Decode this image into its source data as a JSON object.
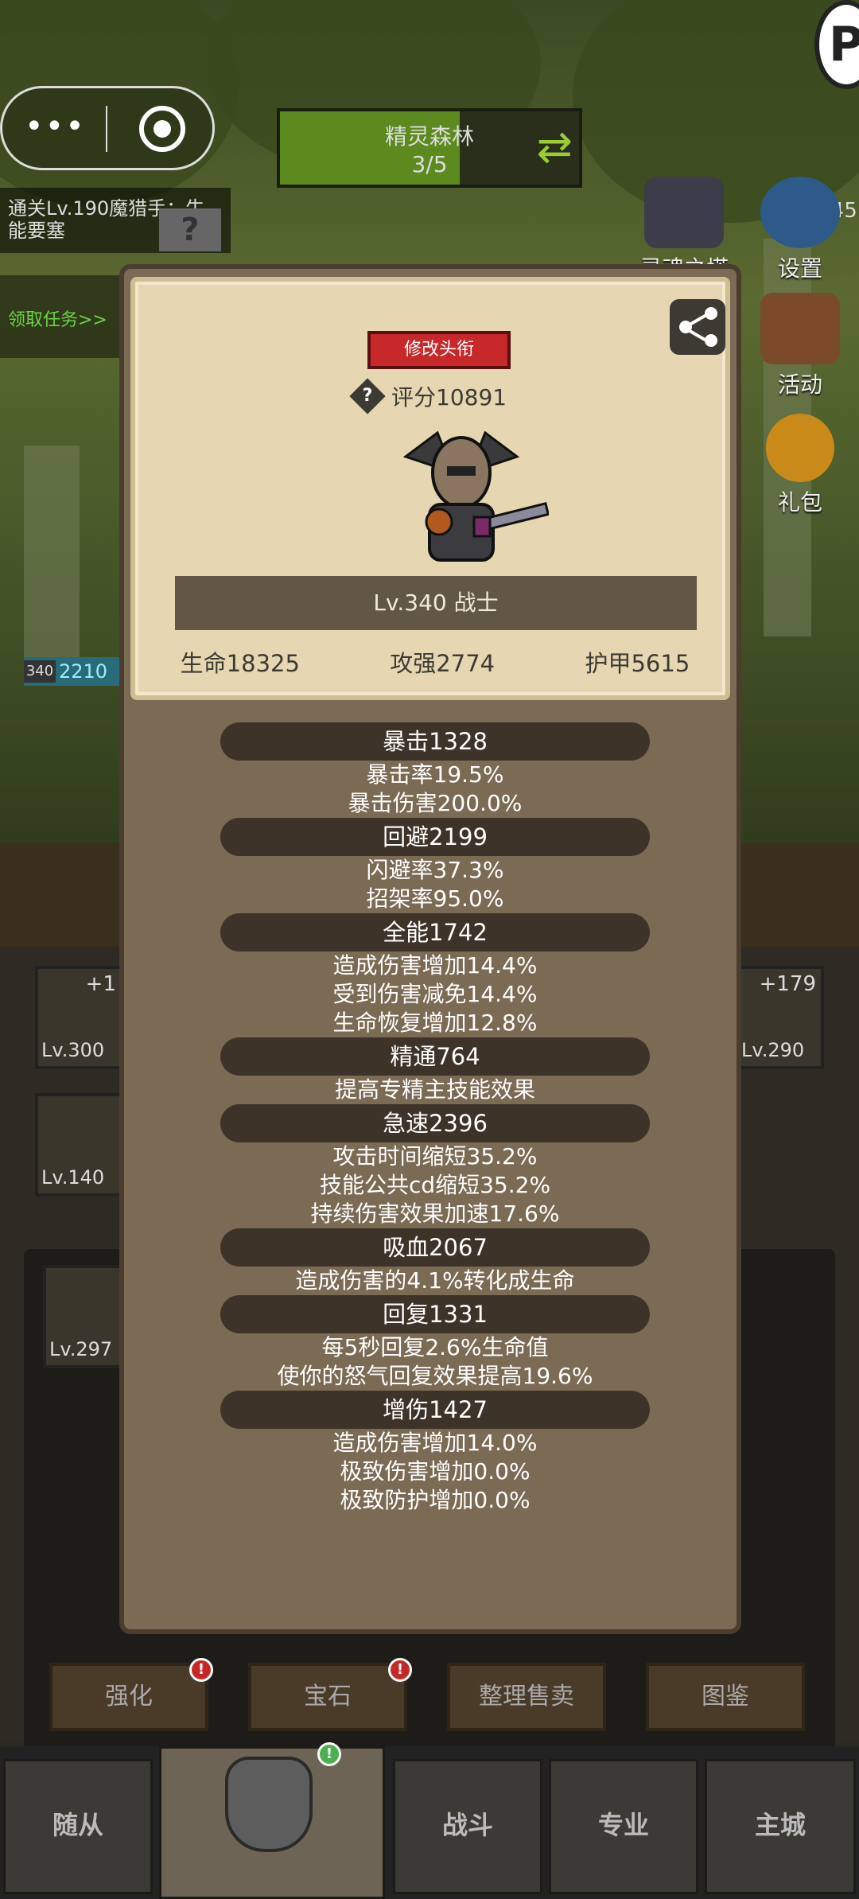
{
  "top": {
    "map_name": "精灵森林",
    "map_progress": "3/5",
    "map_progress_fraction": 0.6,
    "stage_info": "通关Lv.190魔猎手：牛能要塞",
    "task_link": "领取任务>>",
    "player_level_badge": "Lv.445",
    "capsule_menu_icon": "more-dots-icon",
    "capsule_close_icon": "record-circle-icon"
  },
  "side_buttons": [
    {
      "label": "灵魂之塔",
      "icon": "tower-icon"
    },
    {
      "label": "设置",
      "icon": "gear-icon"
    },
    {
      "label": "活动",
      "icon": "scroll-icon"
    },
    {
      "label": "礼包",
      "icon": "gift-coin-icon"
    }
  ],
  "hero_bar": {
    "level": "340",
    "value": "2210"
  },
  "equip_slots": [
    {
      "level": "Lv.300",
      "plus": "+1"
    },
    {
      "level": "Lv.290",
      "plus": "+179"
    },
    {
      "level": "Lv.140",
      "plus": ""
    },
    {
      "level": "Lv.297",
      "plus": ""
    }
  ],
  "panel": {
    "edit_title_button": "修改头衔",
    "rating": "评分10891",
    "hero_name": "Lv.340 战士",
    "core_stats": [
      "生命18325",
      "攻强2774",
      "护甲5615"
    ],
    "groups": [
      {
        "header": "暴击1328",
        "lines": [
          "暴击率19.5%",
          "暴击伤害200.0%"
        ]
      },
      {
        "header": "回避2199",
        "lines": [
          "闪避率37.3%",
          "招架率95.0%"
        ]
      },
      {
        "header": "全能1742",
        "lines": [
          "造成伤害增加14.4%",
          "受到伤害减免14.4%",
          "生命恢复增加12.8%"
        ]
      },
      {
        "header": "精通764",
        "lines": [
          "提高专精主技能效果"
        ]
      },
      {
        "header": "急速2396",
        "lines": [
          "攻击时间缩短35.2%",
          "技能公共cd缩短35.2%",
          "持续伤害效果加速17.6%"
        ]
      },
      {
        "header": "吸血2067",
        "lines": [
          "造成伤害的4.1%转化成生命"
        ]
      },
      {
        "header": "回复1331",
        "lines": [
          "每5秒回复2.6%生命值",
          "使你的怒气回复效果提高19.6%"
        ]
      },
      {
        "header": "增伤1427",
        "lines": [
          "造成伤害增加14.0%",
          "极致伤害增加0.0%",
          "极致防护增加0.0%"
        ]
      }
    ]
  },
  "actions": [
    {
      "label": "强化",
      "alert": "!"
    },
    {
      "label": "宝石",
      "alert": "!"
    },
    {
      "label": "整理售卖",
      "alert": ""
    },
    {
      "label": "图鉴",
      "alert": ""
    }
  ],
  "nav": [
    {
      "label": "随从",
      "active": false
    },
    {
      "label": "装备",
      "active": true
    },
    {
      "label": "战斗",
      "active": false
    },
    {
      "label": "专业",
      "active": false
    },
    {
      "label": "主城",
      "active": false
    }
  ],
  "colors": {
    "accent_red": "#c7282a",
    "panel_bg": "#7b6a54",
    "card_bg": "#e6d7b2",
    "header_bg": "#3d3328"
  }
}
